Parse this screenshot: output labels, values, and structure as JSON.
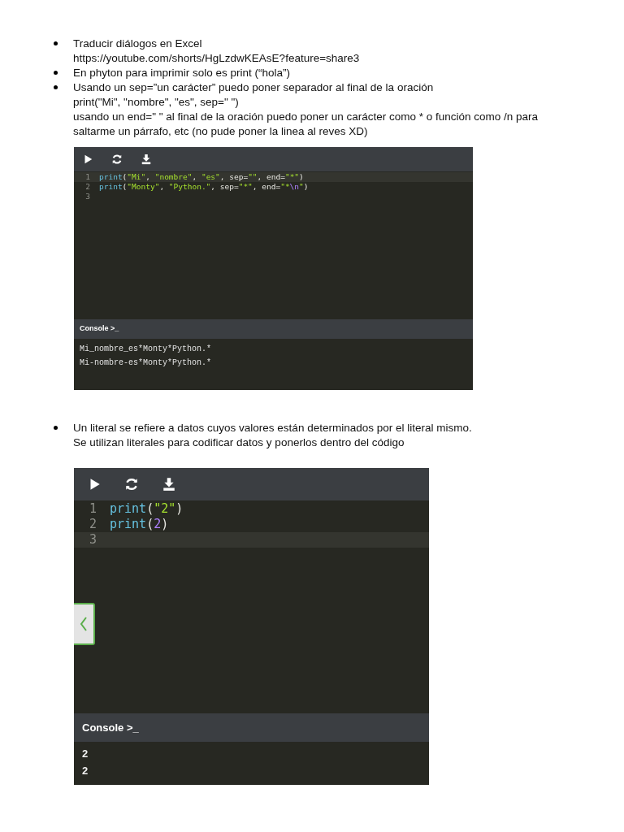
{
  "blocks": [
    {
      "kind": "bullet",
      "lines": [
        "Traducir diálogos en Excel",
        "https://youtube.com/shorts/HgLzdwKEAsE?feature=share3"
      ]
    },
    {
      "kind": "bullet",
      "lines": [
        "En phyton para imprimir solo es print (“hola”)"
      ]
    },
    {
      "kind": "bullet",
      "lines": [
        "Usando un sep=”un carácter” puedo poner separador al final de la oración",
        "print(\"Mi\", \"nombre\", \"es\", sep=\" \")",
        "usando un end=\" \" al final de la oración puedo poner un carácter como * o función como /n para saltarme un párrafo, etc (no pude poner la linea al reves XD)"
      ]
    },
    {
      "kind": "editor",
      "side_tab": false,
      "console_label": "Console >_",
      "lines": [
        {
          "number": "1",
          "active": true,
          "tokens": [
            {
              "kind": "func",
              "text": "print"
            },
            {
              "kind": "punct",
              "text": "("
            },
            {
              "kind": "string",
              "text": "\"Mi\""
            },
            {
              "kind": "punct",
              "text": ", "
            },
            {
              "kind": "string",
              "text": "\"nombre\""
            },
            {
              "kind": "punct",
              "text": ", "
            },
            {
              "kind": "string",
              "text": "\"es\""
            },
            {
              "kind": "punct",
              "text": ", sep="
            },
            {
              "kind": "string",
              "text": "\"\""
            },
            {
              "kind": "punct",
              "text": ", end="
            },
            {
              "kind": "string",
              "text": "\"*\""
            },
            {
              "kind": "punct",
              "text": ")"
            }
          ]
        },
        {
          "number": "2",
          "active": false,
          "tokens": [
            {
              "kind": "func",
              "text": "print"
            },
            {
              "kind": "punct",
              "text": "("
            },
            {
              "kind": "string",
              "text": "\"Monty\""
            },
            {
              "kind": "punct",
              "text": ", "
            },
            {
              "kind": "string",
              "text": "\"Python.\""
            },
            {
              "kind": "punct",
              "text": ", sep="
            },
            {
              "kind": "string",
              "text": "\"*\""
            },
            {
              "kind": "punct",
              "text": ", end="
            },
            {
              "kind": "string",
              "text": "\"*"
            },
            {
              "kind": "escape",
              "text": "\\n"
            },
            {
              "kind": "string",
              "text": "\""
            },
            {
              "kind": "punct",
              "text": ")"
            }
          ]
        },
        {
          "number": "3",
          "active": false
        }
      ],
      "output": [
        "Mi_nombre_es*Monty*Python.*",
        "Mi-nombre-es*Monty*Python.*"
      ]
    },
    {
      "kind": "bullet",
      "lines": [
        "Un literal se refiere a datos cuyos valores están determinados por el literal mismo.",
        "Se utilizan literales para codificar datos y ponerlos dentro del código"
      ]
    },
    {
      "kind": "editor",
      "side_tab": true,
      "console_label": "Console >_",
      "lines": [
        {
          "number": "1",
          "active": false,
          "tokens": [
            {
              "kind": "func",
              "text": "print"
            },
            {
              "kind": "punct",
              "text": "("
            },
            {
              "kind": "string",
              "text": "\"2\""
            },
            {
              "kind": "punct",
              "text": ")"
            }
          ]
        },
        {
          "number": "2",
          "active": false,
          "tokens": [
            {
              "kind": "func",
              "text": "print"
            },
            {
              "kind": "punct",
              "text": "("
            },
            {
              "kind": "number",
              "text": "2"
            },
            {
              "kind": "punct",
              "text": ")"
            }
          ]
        },
        {
          "number": "3",
          "active": true
        }
      ],
      "output": [
        "2",
        "2"
      ]
    }
  ]
}
